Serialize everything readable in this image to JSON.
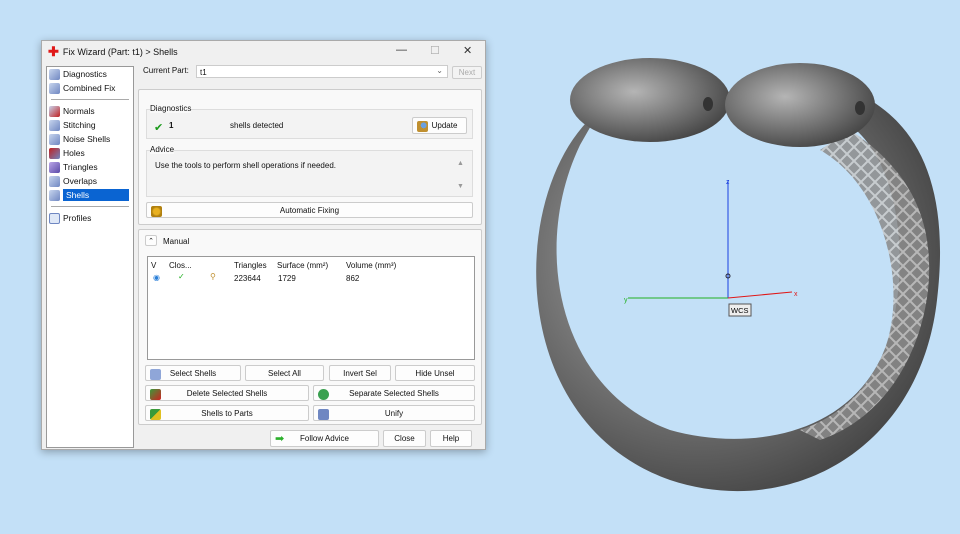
{
  "window": {
    "title": "Fix Wizard (Part: t1) > Shells",
    "minimize": "—",
    "maximize": "☐",
    "close": "✕"
  },
  "sidebar": {
    "items": [
      {
        "label": "Diagnostics"
      },
      {
        "label": "Combined Fix"
      },
      {
        "label": "Normals"
      },
      {
        "label": "Stitching"
      },
      {
        "label": "Noise Shells"
      },
      {
        "label": "Holes"
      },
      {
        "label": "Triangles"
      },
      {
        "label": "Overlaps"
      },
      {
        "label": "Shells"
      },
      {
        "label": "Profiles"
      }
    ],
    "selected": "Shells"
  },
  "current_part": {
    "label": "Current Part:",
    "value": "t1",
    "next": "Next"
  },
  "diagnostics": {
    "title": "Diagnostics",
    "count": "1",
    "text": "shells detected",
    "update": "Update"
  },
  "advice": {
    "title": "Advice",
    "text": "Use the tools to perform shell operations if needed."
  },
  "automatic_fixing": "Automatic Fixing",
  "manual": {
    "title": "Manual",
    "columns": [
      "V",
      "Clos...",
      "",
      "Triangles",
      "Surface (mm²)",
      "Volume (mm³)"
    ],
    "rows": [
      {
        "triangles": "223644",
        "surface": "1729",
        "volume": "862"
      }
    ]
  },
  "buttons": {
    "select_shells": "Select Shells",
    "select_all": "Select All",
    "invert_sel": "Invert Sel",
    "hide_unsel": "Hide Unsel",
    "delete_selected": "Delete Selected Shells",
    "separate_selected": "Separate Selected Shells",
    "shells_to_parts": "Shells to Parts",
    "unify": "Unify",
    "follow_advice": "Follow Advice",
    "close": "Close",
    "help": "Help"
  },
  "viewport": {
    "axes": {
      "x": "x",
      "y": "y",
      "z": "z"
    },
    "wcs": "WCS"
  }
}
